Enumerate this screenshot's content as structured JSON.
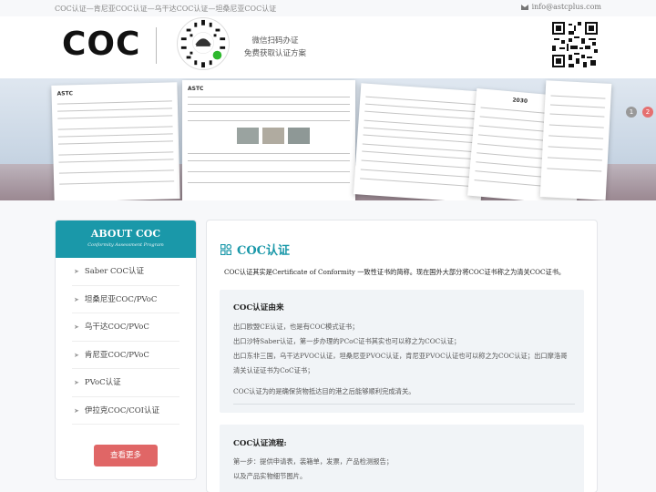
{
  "topbar": {
    "breadcrumb": "COC认证—肯尼亚COC认证—乌干达COC认证—坦桑尼亚COC认证",
    "email": "info@astcplus.com"
  },
  "header": {
    "logo": "COC",
    "scan_line1": "微信扫码办证",
    "scan_line2": "免费获取认证方案"
  },
  "banner": {
    "cert1_title": "ASTC",
    "cert2_title": "ASTC",
    "cert5_title": "2030",
    "pager": [
      "1",
      "2"
    ]
  },
  "sidebar": {
    "title": "ABOUT COC",
    "subtitle": "Conformity Assessment Program",
    "items": [
      "Saber COC认证",
      "坦桑尼亚COC/PVoC",
      "乌干达COC/PVoC",
      "肯尼亚COC/PVoC",
      "PVoC认证",
      "伊拉克COC/COI认证"
    ],
    "more_button": "查看更多"
  },
  "main": {
    "title": "COC认证",
    "intro": "COC认证其实是Certificate of Conformity 一致性证书的简称。现在国外大部分将COC证书称之为清关COC证书。",
    "section1": {
      "heading": "COC认证由来",
      "lines": [
        "出口欧盟CE认证，也是有COC模式证书；",
        "出口沙特Saber认证，第一步办理的PCoC证书其实也可以称之为COC认证；",
        "出口东非三国，乌干达PVOC认证，坦桑尼亚PVOC认证，肯尼亚PVOC认证也可以称之为COC认证；出口摩洛哥",
        "清关认证证书为CoC证书；"
      ],
      "footer": "COC认证为的是确保货物抵达目的港之后能够顺利完成清关。"
    },
    "section2": {
      "heading": "COC认证流程:",
      "lines": [
        "第一步：提供申请表，装箱单，发票，产品检测报告；",
        "以及产品实物细节图片。"
      ]
    }
  },
  "colors": {
    "accent": "#1a98a9",
    "button": "#e06666"
  }
}
